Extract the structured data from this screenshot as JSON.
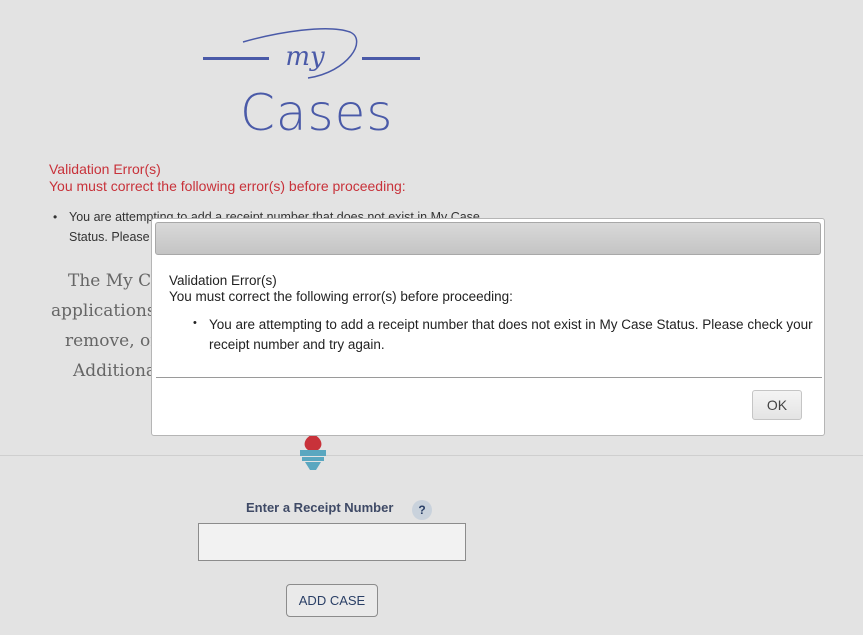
{
  "logo": {
    "script_text": "my",
    "title": "Cases"
  },
  "page_error": {
    "title": "Validation Error(s)",
    "subtitle": "You must correct the following error(s) before proceeding:",
    "message_line1": "You are attempting to add a receipt number that does not exist in My Case",
    "message_line2": "Status. Please"
  },
  "intro_lines": [
    "The My Ca",
    "applications",
    "remove, or",
    "Additiona"
  ],
  "form": {
    "receipt_label": "Enter a Receipt Number",
    "help_label": "?",
    "receipt_value": "",
    "add_button": "ADD CASE"
  },
  "dialog": {
    "title": "Validation Error(s)",
    "subtitle": "You must correct the following error(s) before proceeding:",
    "message": "You are attempting to add a receipt number that does not exist in My Case Status. Please check your receipt number and try again.",
    "ok_label": "OK"
  },
  "colors": {
    "brand": "#4a5aa8",
    "error": "#c8323a",
    "background": "#e3e3e3",
    "torch": "#c8323a",
    "torch_base": "#5aa7c0"
  }
}
